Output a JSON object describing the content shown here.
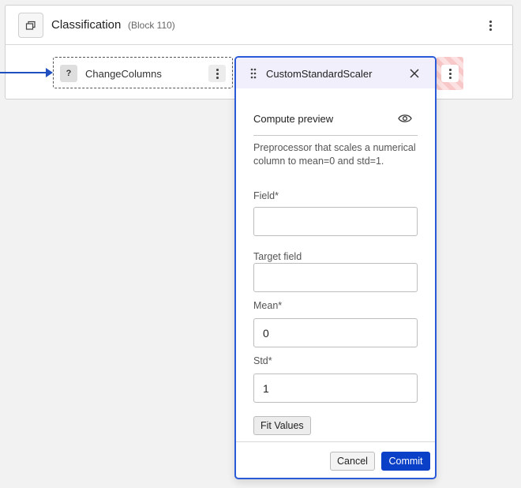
{
  "block": {
    "title": "Classification",
    "subtitle": "(Block 110)"
  },
  "node": {
    "badge": "?",
    "label": "ChangeColumns"
  },
  "panel": {
    "title": "CustomStandardScaler",
    "compute_preview_label": "Compute preview",
    "description": "Preprocessor that scales a numerical column to mean=0 and std=1.",
    "fields": {
      "field": {
        "label": "Field*",
        "value": ""
      },
      "target_field": {
        "label": "Target field",
        "value": ""
      },
      "mean": {
        "label": "Mean*",
        "value": "0"
      },
      "std": {
        "label": "Std*",
        "value": "1"
      }
    },
    "fit_values_label": "Fit Values",
    "cancel_label": "Cancel",
    "commit_label": "Commit"
  },
  "colors": {
    "accent": "#2a5ad8",
    "commit": "#0a3fc8",
    "edge": "#2050c0",
    "header_bg": "#f1effb"
  },
  "icons": {
    "block_icon": "window-stack-icon",
    "drag": "drag-handle-icon",
    "close": "close-icon",
    "preview": "eye-icon",
    "menu": "kebab-menu-icon"
  }
}
